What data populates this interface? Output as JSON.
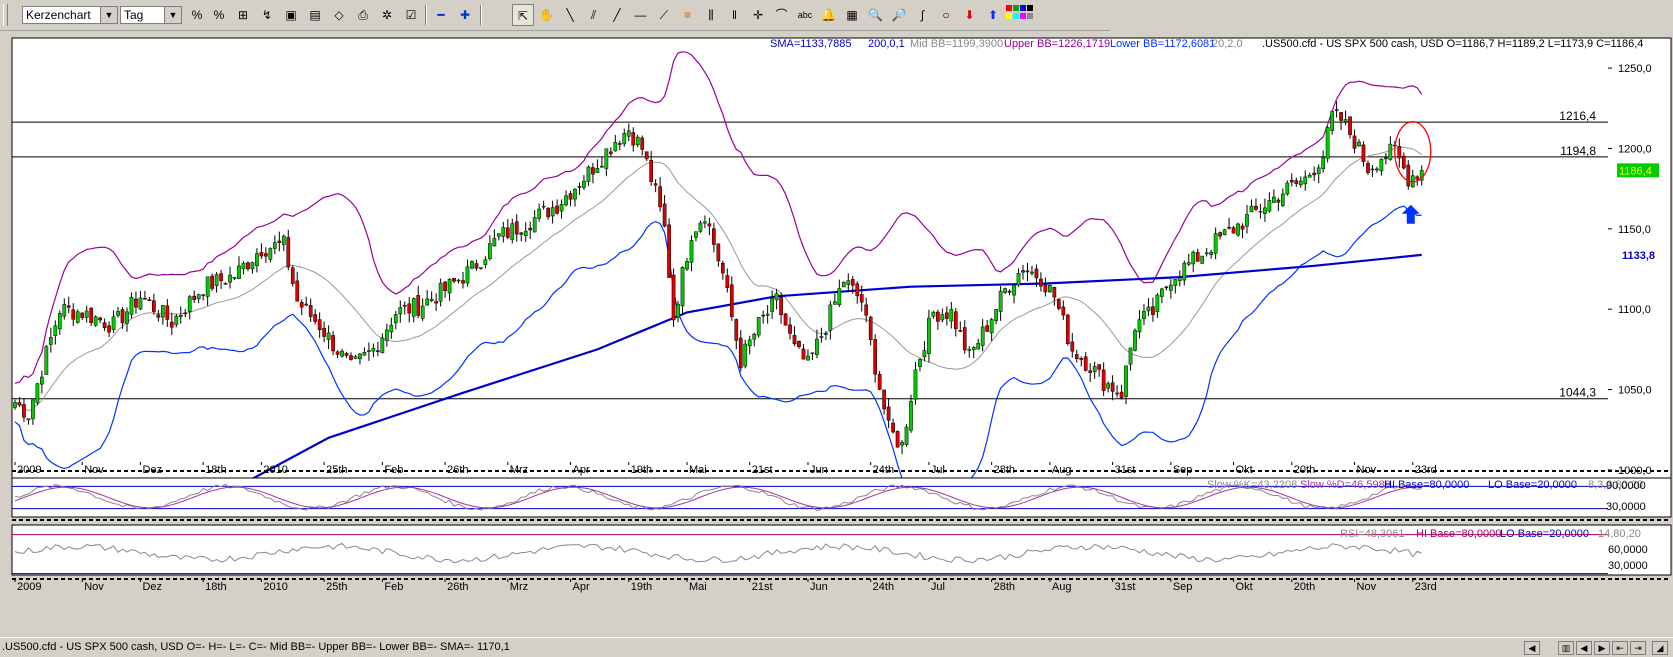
{
  "toolbar": {
    "chart_type": "Kerzenchart",
    "period": "Tag",
    "tools": [
      {
        "name": "crosshair-cursor-icon",
        "glyph": "⇱"
      },
      {
        "name": "hand-tool-icon",
        "glyph": "✋"
      },
      {
        "name": "line-tool-icon",
        "glyph": "╲"
      },
      {
        "name": "parallel-lines-tool-icon",
        "glyph": "⫽"
      },
      {
        "name": "trendline-tool-icon",
        "glyph": "╱"
      },
      {
        "name": "horizontal-line-tool-icon",
        "glyph": "—"
      },
      {
        "name": "fan-tool-icon",
        "glyph": "⟋"
      },
      {
        "name": "fibonacci-tool-icon",
        "glyph": "≡"
      },
      {
        "name": "fibonacci-timezone-tool-icon",
        "glyph": "⫼"
      },
      {
        "name": "vertical-lines-tool-icon",
        "glyph": "‖"
      },
      {
        "name": "crosshair-tool-icon",
        "glyph": "✛"
      },
      {
        "name": "arc-tool-icon",
        "glyph": "⌒"
      },
      {
        "name": "text-tool-icon",
        "glyph": "abc"
      },
      {
        "name": "alert-bell-icon",
        "glyph": "🔔"
      },
      {
        "name": "calculator-icon",
        "glyph": "▦"
      },
      {
        "name": "zoom-in-icon",
        "glyph": "🔍"
      },
      {
        "name": "zoom-area-icon",
        "glyph": "🔎"
      },
      {
        "name": "freehand-tool-icon",
        "glyph": "∫"
      },
      {
        "name": "ellipse-tool-icon",
        "glyph": "○"
      },
      {
        "name": "arrow-down-tool-icon",
        "glyph": "⬇"
      },
      {
        "name": "arrow-up-tool-icon",
        "glyph": "⬆"
      }
    ]
  },
  "header": {
    "sma": "SMA=1133,7885",
    "sma_params": "200,0,1",
    "mid_bb": "Mid BB=1199,3900",
    "upper_bb": "Upper BB=1226,1719",
    "lower_bb": "Lower BB=1172,6081",
    "bb_params": "20,2,0",
    "instrument": ".US500.cfd - US SPX 500 cash, USD O=1186,7 H=1189,2 L=1173,9 C=1186,4"
  },
  "stoch_label": {
    "k": "Slow %K=43,2208",
    "d": "Slow %D=46,5988",
    "hi": "HI Base=80,0000",
    "lo": "LO Base=20,0000",
    "params": "8,3,3,80,20"
  },
  "rsi_label": {
    "rsi": "RSI=48,3061",
    "hi": "HI Base=80,0000",
    "lo": "LO Base=20,0000",
    "params": "14,80,20"
  },
  "stoch_axis": [
    "90,0000",
    "30,0000"
  ],
  "rsi_axis": [
    "60,0000",
    "30,0000"
  ],
  "statusbar": {
    "text": ".US500.cfd - US SPX 500 cash, USD O=- H=- L=- C=-  Mid BB=- Upper BB=- Lower BB=- SMA=-    1170,1"
  },
  "colors": {
    "up": "#00cc00",
    "down": "#dd0000",
    "sma": "#0000cc",
    "bb_outer_upper": "#990099",
    "bb_outer_lower": "#0033ff",
    "bb_mid": "#999999",
    "hline": "#000000",
    "annotation_circle": "#ff0000",
    "annotation_arrow": "#0033ff",
    "rsi_line": "#888888",
    "stoch_k": "#888888",
    "stoch_d": "#aa33aa"
  },
  "chart_data": {
    "type": "candlestick",
    "instrument": ".US500.cfd - US SPX 500 cash, USD",
    "ylim": [
      990,
      1265
    ],
    "y_ticks": [
      {
        "value": 1250,
        "label": "1250,0"
      },
      {
        "value": 1200,
        "label": "1200,0"
      },
      {
        "value": 1150,
        "label": "1150,0"
      },
      {
        "value": 1100,
        "label": "1100,0"
      },
      {
        "value": 1050,
        "label": "1050,0"
      },
      {
        "value": 1000,
        "label": "1000,0"
      }
    ],
    "x_labels": [
      {
        "i": 0,
        "label": "2009"
      },
      {
        "i": 15,
        "label": "Nov"
      },
      {
        "i": 28,
        "label": "Dez"
      },
      {
        "i": 42,
        "label": "18th"
      },
      {
        "i": 55,
        "label": "2010"
      },
      {
        "i": 69,
        "label": "25th"
      },
      {
        "i": 82,
        "label": "Feb"
      },
      {
        "i": 96,
        "label": "26th"
      },
      {
        "i": 110,
        "label": "Mrz"
      },
      {
        "i": 124,
        "label": "Apr"
      },
      {
        "i": 137,
        "label": "19th"
      },
      {
        "i": 150,
        "label": "Mai"
      },
      {
        "i": 164,
        "label": "21st"
      },
      {
        "i": 177,
        "label": "Jun"
      },
      {
        "i": 191,
        "label": "24th"
      },
      {
        "i": 204,
        "label": "Jul"
      },
      {
        "i": 218,
        "label": "28th"
      },
      {
        "i": 231,
        "label": "Aug"
      },
      {
        "i": 245,
        "label": "31st"
      },
      {
        "i": 258,
        "label": "Sep"
      },
      {
        "i": 272,
        "label": "Okt"
      },
      {
        "i": 285,
        "label": "20th"
      },
      {
        "i": 299,
        "label": "Nov"
      },
      {
        "i": 312,
        "label": "23rd"
      }
    ],
    "hlines": [
      {
        "value": 1216.4,
        "label": "1216,4"
      },
      {
        "value": 1194.8,
        "label": "1194,8"
      },
      {
        "value": 1044.3,
        "label": "1044,3"
      }
    ],
    "last_price": {
      "value": 1186.4,
      "label": "1186,4"
    },
    "sma_last": {
      "value": 1133.8,
      "label": "1133,8"
    },
    "anchors": [
      [
        0,
        1042
      ],
      [
        3,
        1035
      ],
      [
        10,
        1100
      ],
      [
        15,
        1098
      ],
      [
        22,
        1090
      ],
      [
        28,
        1108
      ],
      [
        35,
        1092
      ],
      [
        42,
        1114
      ],
      [
        49,
        1121
      ],
      [
        55,
        1138
      ],
      [
        60,
        1140
      ],
      [
        63,
        1105
      ],
      [
        68,
        1090
      ],
      [
        75,
        1063
      ],
      [
        80,
        1075
      ],
      [
        85,
        1098
      ],
      [
        90,
        1102
      ],
      [
        96,
        1112
      ],
      [
        102,
        1125
      ],
      [
        108,
        1145
      ],
      [
        115,
        1155
      ],
      [
        121,
        1165
      ],
      [
        128,
        1185
      ],
      [
        134,
        1205
      ],
      [
        137,
        1212
      ],
      [
        140,
        1200
      ],
      [
        143,
        1172
      ],
      [
        145,
        1150
      ],
      [
        147,
        1095
      ],
      [
        151,
        1148
      ],
      [
        154,
        1160
      ],
      [
        158,
        1122
      ],
      [
        162,
        1068
      ],
      [
        166,
        1090
      ],
      [
        170,
        1105
      ],
      [
        174,
        1075
      ],
      [
        177,
        1065
      ],
      [
        181,
        1090
      ],
      [
        185,
        1118
      ],
      [
        189,
        1105
      ],
      [
        192,
        1065
      ],
      [
        195,
        1025
      ],
      [
        198,
        1015
      ],
      [
        201,
        1062
      ],
      [
        205,
        1098
      ],
      [
        209,
        1098
      ],
      [
        213,
        1070
      ],
      [
        217,
        1090
      ],
      [
        221,
        1112
      ],
      [
        225,
        1126
      ],
      [
        229,
        1120
      ],
      [
        232,
        1108
      ],
      [
        236,
        1075
      ],
      [
        240,
        1065
      ],
      [
        243,
        1055
      ],
      [
        247,
        1048
      ],
      [
        250,
        1090
      ],
      [
        254,
        1098
      ],
      [
        258,
        1120
      ],
      [
        263,
        1130
      ],
      [
        268,
        1142
      ],
      [
        273,
        1152
      ],
      [
        278,
        1163
      ],
      [
        283,
        1173
      ],
      [
        288,
        1181
      ],
      [
        292,
        1196
      ],
      [
        294,
        1220
      ],
      [
        296,
        1218
      ],
      [
        299,
        1205
      ],
      [
        302,
        1188
      ],
      [
        305,
        1195
      ],
      [
        308,
        1198
      ],
      [
        311,
        1182
      ],
      [
        314,
        1186.4
      ]
    ]
  }
}
